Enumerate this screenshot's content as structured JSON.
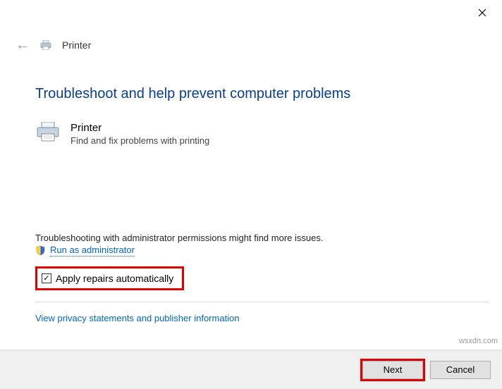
{
  "window": {
    "title": "Printer"
  },
  "heading": "Troubleshoot and help prevent computer problems",
  "section": {
    "title": "Printer",
    "desc": "Find and fix problems with printing"
  },
  "admin": {
    "hint": "Troubleshooting with administrator permissions might find more issues.",
    "run_link": "Run as administrator"
  },
  "checkbox": {
    "label": "Apply repairs automatically",
    "checked": true
  },
  "privacy_link": "View privacy statements and publisher information",
  "footer": {
    "next": "Next",
    "cancel": "Cancel"
  },
  "watermark": "wsxdn.com"
}
